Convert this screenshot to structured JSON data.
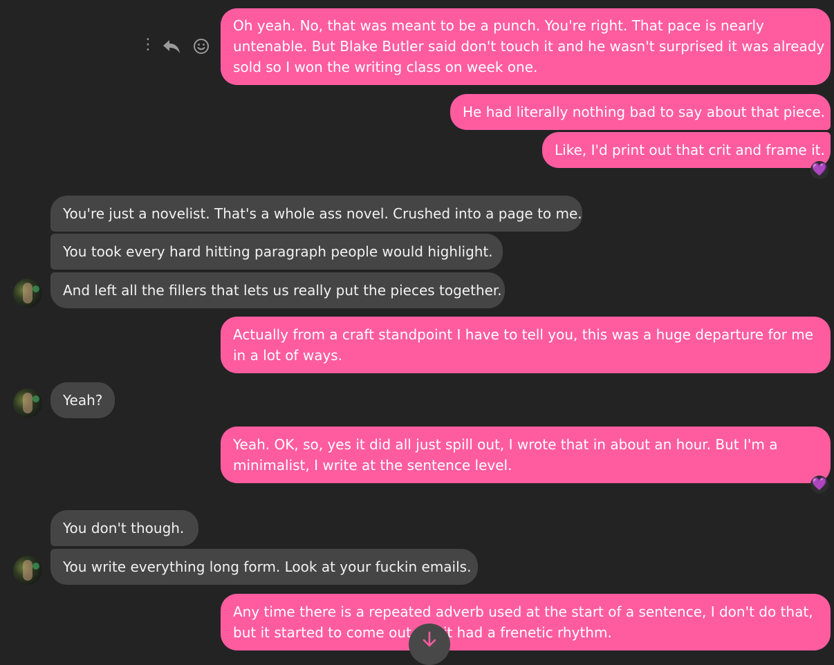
{
  "colors": {
    "outgoing": "#ff5ca0",
    "incoming": "#454545",
    "background": "#232323",
    "reaction": "#9b59f0"
  },
  "hover_actions": [
    "more-options-icon",
    "reply-icon",
    "react-smiley-icon"
  ],
  "messages": [
    {
      "sender": "me",
      "lines": [
        "Oh yeah. No, that was meant to be a punch. You're right. That pace is nearly",
        "untenable. But Blake Butler said don't touch it and he wasn't surprised it was already",
        "sold so I won the writing class on week one."
      ]
    },
    {
      "sender": "me",
      "lines": [
        "He had literally nothing bad to say about that piece."
      ]
    },
    {
      "sender": "me",
      "lines": [
        "Like, I'd print out that crit and frame it."
      ],
      "reaction": "💜"
    },
    {
      "sender": "them",
      "lines": [
        "You're just a novelist. That's a whole ass novel. Crushed into a page to me."
      ]
    },
    {
      "sender": "them",
      "lines": [
        "You took every hard hitting paragraph people would highlight."
      ]
    },
    {
      "sender": "them",
      "lines": [
        "And left all the fillers that lets us really put the pieces together."
      ]
    },
    {
      "sender": "me",
      "lines": [
        "Actually from a craft standpoint I have to tell you, this was a huge departure for me",
        "in a lot of ways."
      ]
    },
    {
      "sender": "them",
      "lines": [
        "Yeah?"
      ]
    },
    {
      "sender": "me",
      "lines": [
        "Yeah. OK, so, yes it did all just spill out, I wrote that in about an hour. But I'm a",
        "minimalist, I write at the sentence level."
      ],
      "reaction": "💜"
    },
    {
      "sender": "them",
      "lines": [
        "You don't though."
      ]
    },
    {
      "sender": "them",
      "lines": [
        "You write everything long form. Look at your fuckin emails."
      ]
    },
    {
      "sender": "me",
      "lines": [
        "Any time there is a repeated adverb used at the start of a sentence, I don't do that,",
        "but it started to come out",
        "it had a frenetic rhythm."
      ]
    }
  ],
  "scroll_down_icon": "arrow-down-icon"
}
